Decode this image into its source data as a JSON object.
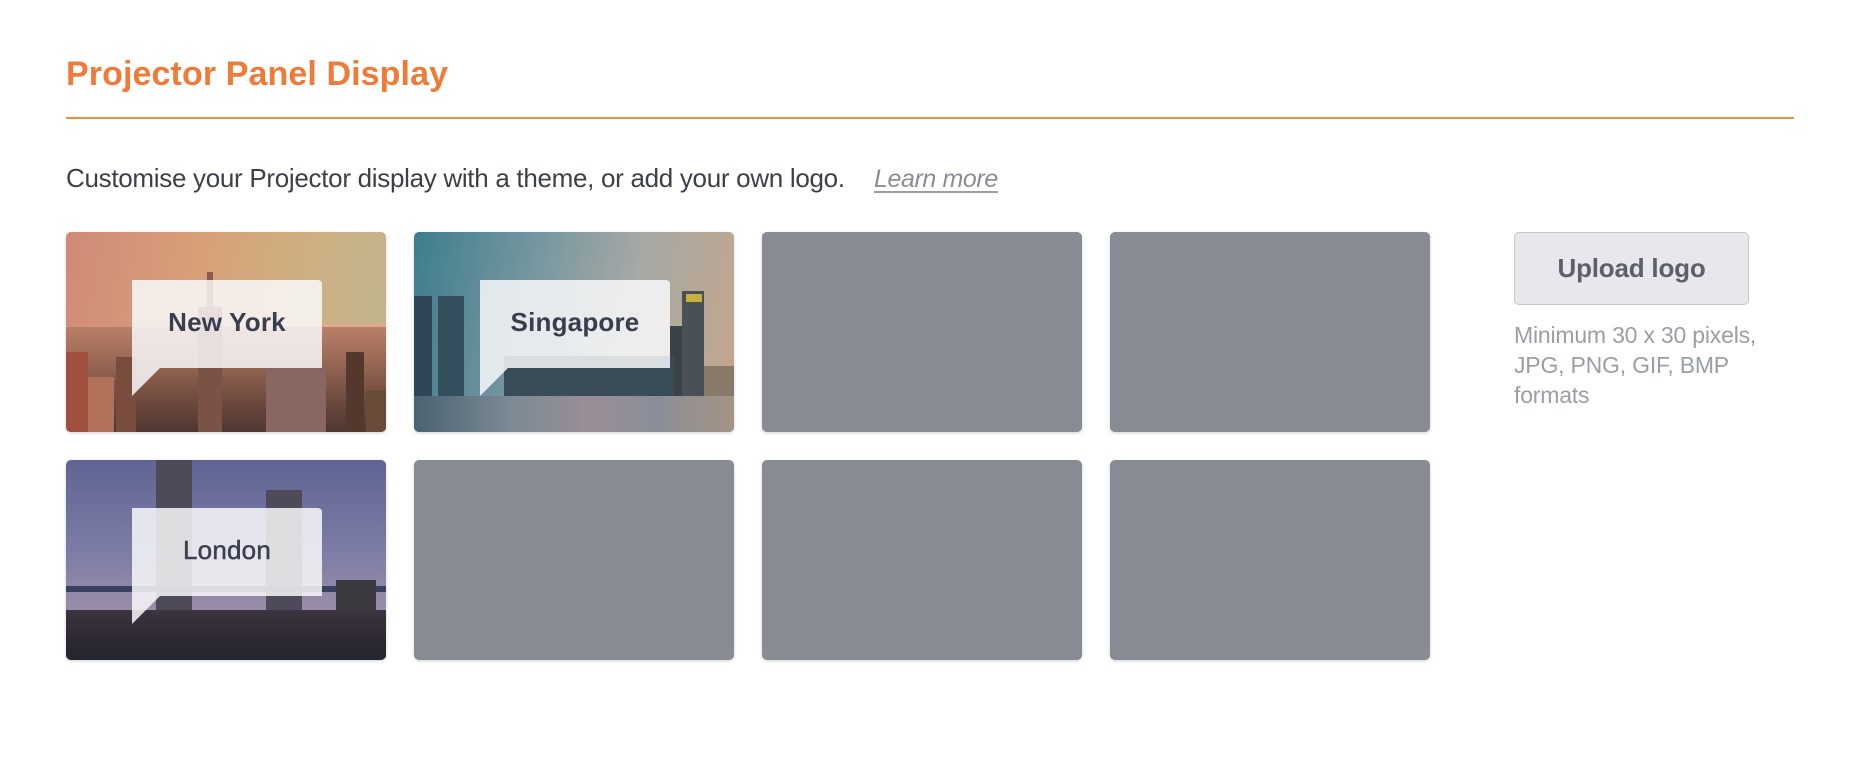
{
  "section": {
    "title": "Projector Panel Display",
    "accent_color": "#f07a38",
    "intro": "Customise your Projector display with a theme, or add your own logo.",
    "learn_more": "Learn more"
  },
  "themes": [
    {
      "name": "New York",
      "type": "image",
      "selected": false
    },
    {
      "name": "Singapore",
      "type": "image",
      "selected": false
    },
    {
      "name": "",
      "type": "empty"
    },
    {
      "name": "",
      "type": "empty"
    },
    {
      "name": "London",
      "type": "image",
      "selected": false
    },
    {
      "name": "",
      "type": "empty"
    },
    {
      "name": "",
      "type": "empty"
    },
    {
      "name": "",
      "type": "empty"
    }
  ],
  "upload": {
    "button_label": "Upload logo",
    "hint_lines": [
      "Minimum 30 x 30 pixels,",
      "JPG, PNG, GIF, BMP",
      "formats"
    ]
  }
}
